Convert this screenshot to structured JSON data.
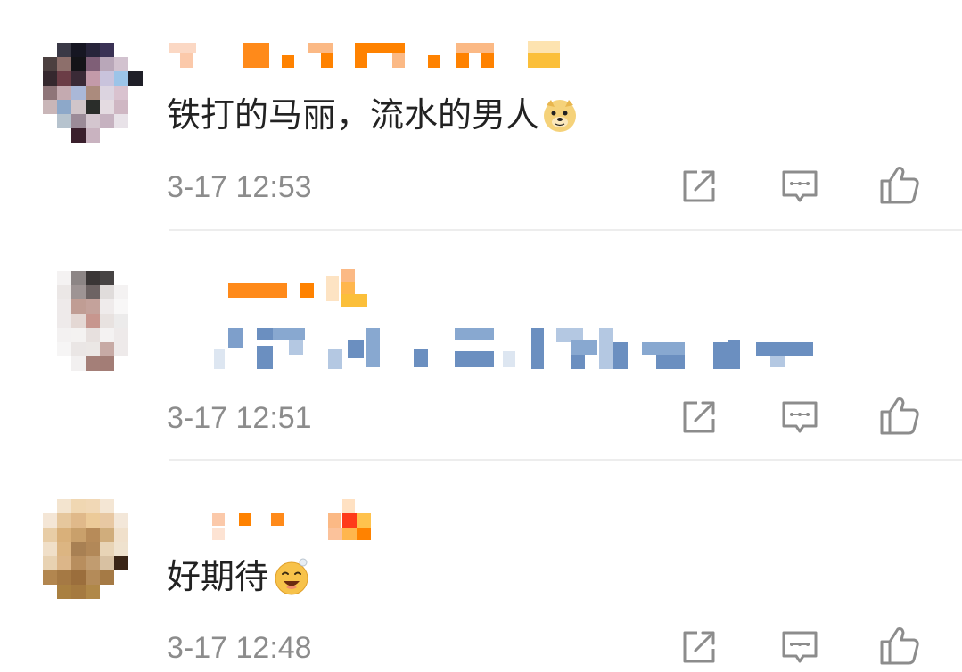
{
  "comments": [
    {
      "text": "铁打的马丽，流水的男人",
      "emoji": "doge-emoji",
      "time": "3-17 12:53"
    },
    {
      "text": "",
      "time": "3-17 12:51"
    },
    {
      "text": "好期待",
      "emoji": "grin-emoji",
      "time": "3-17 12:48"
    }
  ],
  "icons": {
    "repost": "repost-icon",
    "comment": "comment-icon",
    "like": "thumbs-up-icon"
  },
  "colors": {
    "text": "#222222",
    "timestamp": "#8c8c8c",
    "icon": "#8c8c8c",
    "username_orange": "#ff8200",
    "divider": "#ededed"
  }
}
